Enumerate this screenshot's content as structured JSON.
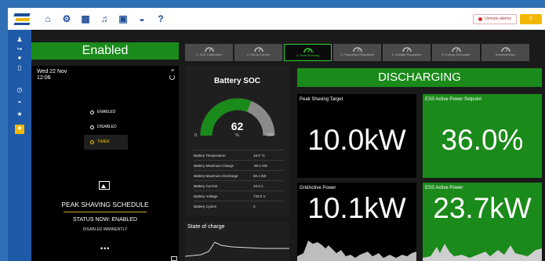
{
  "topbar": {
    "alarm_label": "Unmute alarms",
    "user_badge": "0"
  },
  "icons": {
    "topbar": [
      "home-icon",
      "gear-icon",
      "calendar-icon",
      "bell-icon",
      "grid-icon",
      "dashboard-icon",
      "help-icon"
    ],
    "sidebar": [
      "users-icon",
      "logout-icon",
      "user-icon",
      "device-icon",
      "clock-icon",
      "gauge-icon",
      "star-icon",
      "sun-icon"
    ]
  },
  "banner": {
    "enabled": "Enabled"
  },
  "tabs": [
    {
      "label": "1. SOC Calibration",
      "active": false
    },
    {
      "label": "2. Ramp Control",
      "active": false
    },
    {
      "label": "3. Peak Shaving",
      "active": true
    },
    {
      "label": "4. Frequency Regulation",
      "active": false
    },
    {
      "label": "5. Voltage Regulation",
      "active": false
    },
    {
      "label": "6. Energy Exchange",
      "active": false
    },
    {
      "label": "Administration",
      "active": false
    }
  ],
  "schedule": {
    "date": "Wed 22 Nov",
    "time": "12:06",
    "modes": [
      {
        "label": "ENABLED",
        "selected": false
      },
      {
        "label": "DISABLED",
        "selected": false
      },
      {
        "label": "TIMER",
        "selected": true
      }
    ],
    "title": "PEAK SHAVING SCHEDULE",
    "status": "STATUS NOW: ENABLED",
    "status_sub": "DISABLED IMMINENTLY",
    "more": "•••"
  },
  "battery": {
    "title": "Battery SOC",
    "soc": 62,
    "soc_fraction": 0.62,
    "unit": "%",
    "min": "0",
    "max": "100",
    "stats": [
      {
        "label": "Battery Temperature",
        "value": "18.0 °C"
      },
      {
        "label": "Battery Maximum Charge",
        "value": "-60.1 kW"
      },
      {
        "label": "Battery Maximum Discharge",
        "value": "60.1 kW"
      },
      {
        "label": "Battery Current",
        "value": "34.0 A"
      },
      {
        "label": "Battery Voltage",
        "value": "733.0 V"
      },
      {
        "label": "Battery Cycles",
        "value": "0"
      }
    ],
    "chart_title": "State of charge"
  },
  "power": {
    "status": "DISCHARGING",
    "tiles": [
      {
        "label": "Peak Shaving Target",
        "value": "10.0kW"
      },
      {
        "label": "ESS Active Power Setpoint",
        "value": "36.0%"
      },
      {
        "label": "GridActive Power",
        "value": "10.1kW"
      },
      {
        "label": "ESS Active Power",
        "value": "23.7kW"
      }
    ]
  },
  "colors": {
    "accent_green": "#1a8a1a",
    "tab_active": "#2fd12f",
    "gauge_gray": "#8a8a8a",
    "sidebar_blue": "#1f5aa8",
    "warn_yellow": "#f2b705"
  }
}
